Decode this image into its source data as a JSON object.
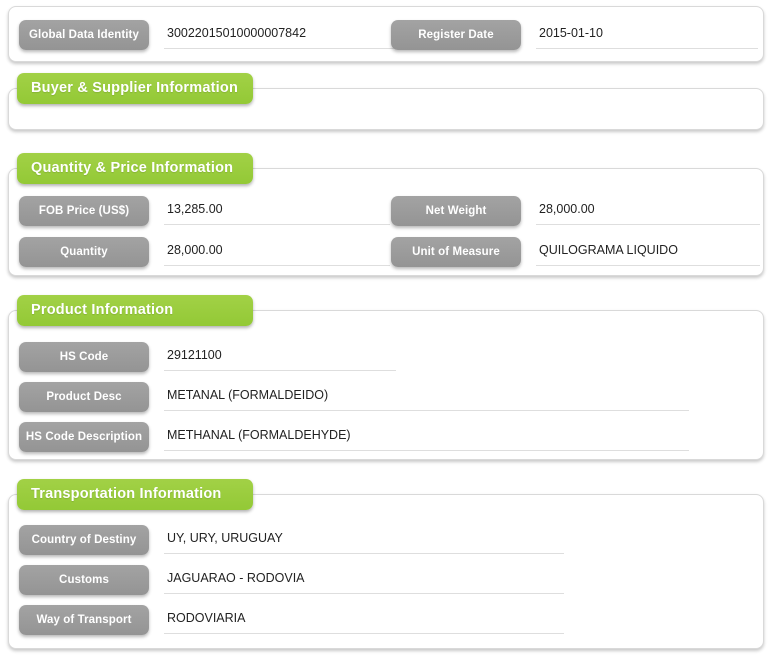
{
  "colors": {
    "section_tab": "#97cb3c",
    "field_label": "#9b9b9b",
    "panel_background": "#ffffff",
    "value_text": "#222222",
    "underline": "#dedede"
  },
  "header_record": {
    "fields": [
      {
        "label": "Global Data Identity",
        "value": "30022015010000007842"
      },
      {
        "label": "Register Date",
        "value": "2015-01-10"
      }
    ]
  },
  "sections": [
    {
      "title": "Buyer & Supplier Information",
      "fields": []
    },
    {
      "title": "Quantity & Price Information",
      "fields": [
        {
          "label": "FOB Price (US$)",
          "value": "13,285.00"
        },
        {
          "label": "Net Weight",
          "value": "28,000.00"
        },
        {
          "label": "Quantity",
          "value": "28,000.00"
        },
        {
          "label": "Unit of Measure",
          "value": "QUILOGRAMA LIQUIDO"
        }
      ]
    },
    {
      "title": "Product Information",
      "fields": [
        {
          "label": "HS Code",
          "value": "29121100"
        },
        {
          "label": "Product Desc",
          "value": "METANAL (FORMALDEIDO)"
        },
        {
          "label": "HS Code Description",
          "value": "METHANAL (FORMALDEHYDE)"
        }
      ]
    },
    {
      "title": "Transportation Information",
      "fields": [
        {
          "label": "Country of Destiny",
          "value": "UY, URY, URUGUAY"
        },
        {
          "label": "Customs",
          "value": "JAGUARAO - RODOVIA"
        },
        {
          "label": "Way of Transport",
          "value": "RODOVIARIA"
        }
      ]
    }
  ]
}
